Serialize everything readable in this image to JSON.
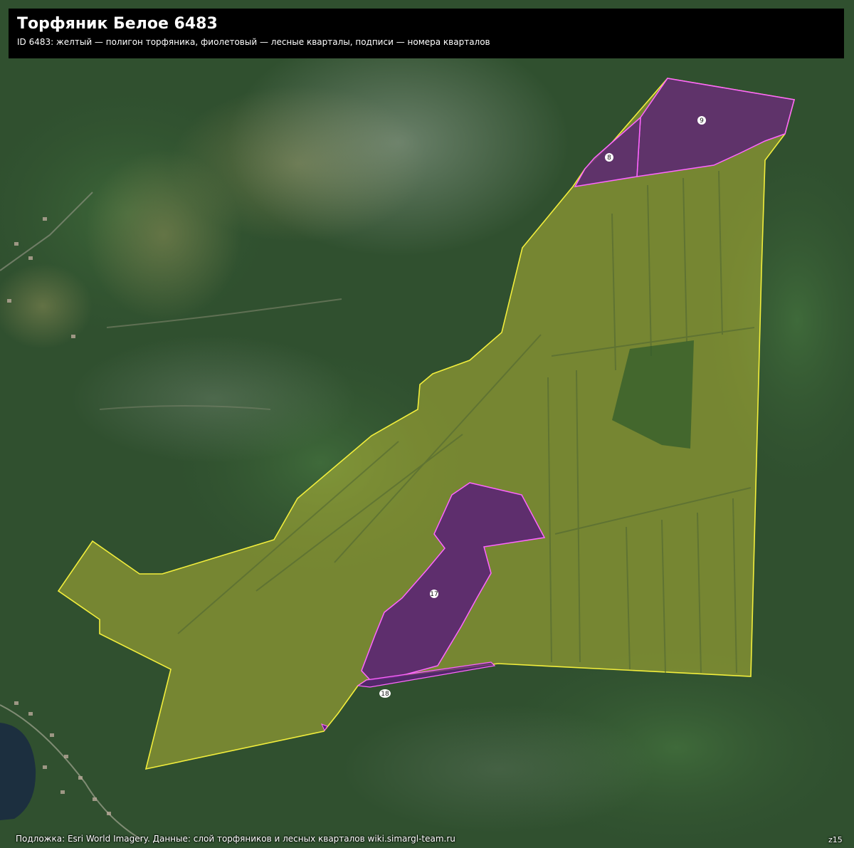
{
  "header": {
    "title": "Торфяник Белое 6483",
    "subtitle": "ID 6483: желтый — полигон торфяника, фиолетовый — лесные кварталы, подписи — номера кварталов"
  },
  "legend_colors": {
    "peatland_fill": "#d8d238",
    "peatland_stroke": "#f2ee3c",
    "quarter_fill": "#5a1e78",
    "quarter_stroke": "#ff66ff"
  },
  "quarters": [
    {
      "number": "9"
    },
    {
      "number": "8"
    },
    {
      "number": "17"
    },
    {
      "number": "18"
    }
  ],
  "footer": {
    "attribution": "Подложка: Esri World Imagery. Данные: слой торфяников и лесных кварталов wiki.simargl-team.ru",
    "zoom": "z15"
  }
}
